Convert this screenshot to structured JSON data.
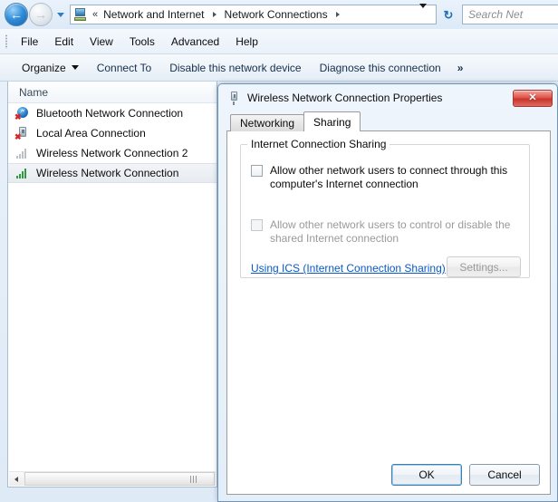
{
  "window": {
    "title": "Network Connections"
  },
  "address_bar": {
    "back_icon": "back-arrow-icon",
    "forward_icon": "forward-arrow-icon",
    "history_icon": "history-dropdown-icon",
    "location_icon": "network-computer-icon",
    "overflow_chevron": "«",
    "crumbs": [
      {
        "label": "Network and Internet"
      },
      {
        "label": "Network Connections"
      }
    ],
    "dropdown_icon": "chevron-down-icon",
    "refresh_icon": "refresh-icon",
    "refresh_glyph": "↻"
  },
  "search": {
    "placeholder": "Search Net"
  },
  "menubar": {
    "items": [
      {
        "label": "File"
      },
      {
        "label": "Edit"
      },
      {
        "label": "View"
      },
      {
        "label": "Tools"
      },
      {
        "label": "Advanced"
      },
      {
        "label": "Help"
      }
    ]
  },
  "toolbar": {
    "organize_label": "Organize",
    "connect_to_label": "Connect To",
    "disable_label": "Disable this network device",
    "diagnose_label": "Diagnose this connection",
    "overflow_label": "»"
  },
  "list": {
    "column_header": "Name",
    "rows": [
      {
        "label": "Bluetooth Network Connection",
        "icon": "bluetooth-disabled-icon",
        "selected": false
      },
      {
        "label": "Local Area Connection",
        "icon": "lan-disabled-icon",
        "selected": false
      },
      {
        "label": "Wireless Network Connection 2",
        "icon": "wireless-inactive-icon",
        "selected": false
      },
      {
        "label": "Wireless Network Connection",
        "icon": "wireless-active-icon",
        "selected": true
      }
    ],
    "scroll_left_icon": "scroll-left-arrow-icon"
  },
  "dialog": {
    "title": "Wireless Network Connection Properties",
    "icon": "network-adapter-icon",
    "close_label": "✕",
    "tabs": [
      {
        "label": "Networking",
        "active": false
      },
      {
        "label": "Sharing",
        "active": true
      }
    ],
    "group": {
      "legend": "Internet Connection Sharing",
      "checkbox_1": {
        "label": "Allow other network users to connect through this computer's Internet connection",
        "checked": false,
        "enabled": true
      },
      "checkbox_2": {
        "label": "Allow other network users to control or disable the shared Internet connection",
        "checked": false,
        "enabled": false
      },
      "link_label": "Using ICS (Internet Connection Sharing)",
      "settings_label": "Settings...",
      "settings_enabled": false
    },
    "ok_label": "OK",
    "cancel_label": "Cancel"
  },
  "colors": {
    "link": "#0a59c4",
    "accent": "#2f8ddb",
    "active_signal": "#2f9b3f",
    "close_button": "#c8362c",
    "disabled_text": "#9a9a9a"
  }
}
